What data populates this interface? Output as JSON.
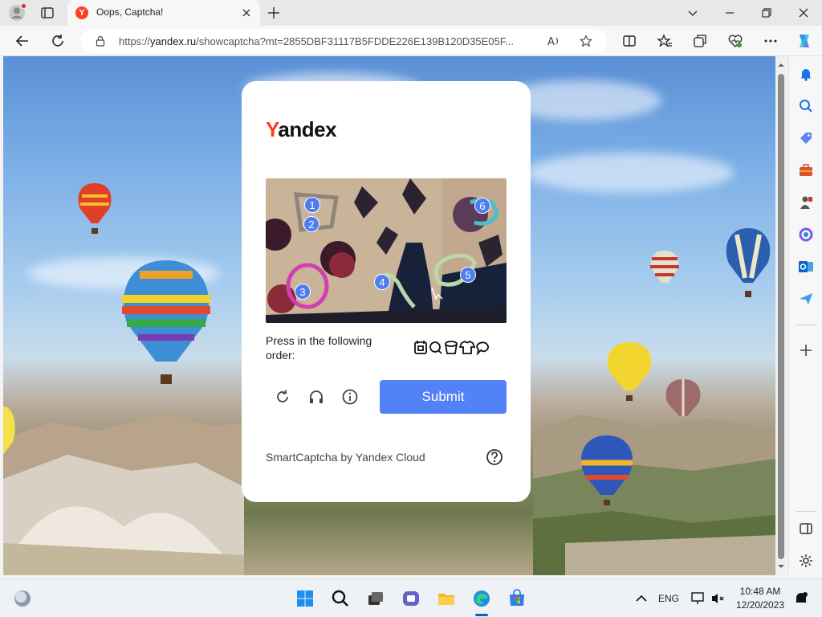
{
  "browser": {
    "tab": {
      "title": "Oops, Captcha!",
      "favicon_letter": "Y",
      "favicon_color": "#fc3f1d"
    },
    "address": {
      "url_prefix": "https://",
      "url_host": "yandex.ru",
      "url_rest": "/showcaptcha?mt=2855DBF31117B5FDDE226E139B120D35E05F..."
    }
  },
  "card": {
    "logo_y": "Y",
    "logo_rest": "andex",
    "instruction": "Press in the following order:",
    "order_icons": [
      "calendar-icon",
      "magnifier-icon",
      "bucket-icon",
      "shirt-icon",
      "speech-bubble-icon"
    ],
    "markers": [
      "1",
      "2",
      "3",
      "4",
      "5",
      "6"
    ],
    "submit_label": "Submit",
    "footer": "SmartCaptcha by Yandex Cloud",
    "accent_color": "#5282f5"
  },
  "taskbar": {
    "lang": "ENG",
    "time": "10:48 AM",
    "date": "12/20/2023"
  }
}
